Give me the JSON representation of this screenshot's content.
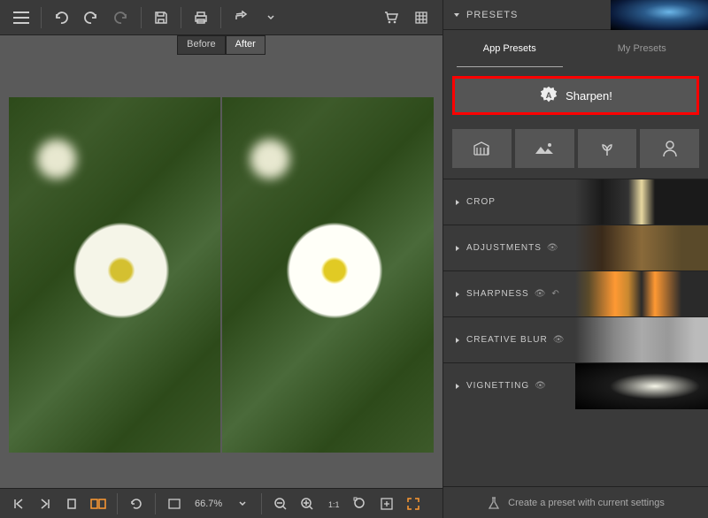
{
  "toolbar": {
    "before_label": "Before",
    "after_label": "After",
    "zoom_value": "66.7%"
  },
  "sidebar": {
    "presets_title": "PRESETS",
    "tabs": {
      "app": "App Presets",
      "my": "My Presets"
    },
    "sharpen_label": "Sharpen!",
    "categories": [
      "architecture",
      "landscape",
      "macro",
      "portrait"
    ],
    "panels": {
      "crop": "CROP",
      "adjustments": "ADJUSTMENTS",
      "sharpness": "SHARPNESS",
      "creative_blur": "CREATIVE BLUR",
      "vignetting": "VIGNETTING"
    },
    "create_preset": "Create a preset with current settings"
  }
}
